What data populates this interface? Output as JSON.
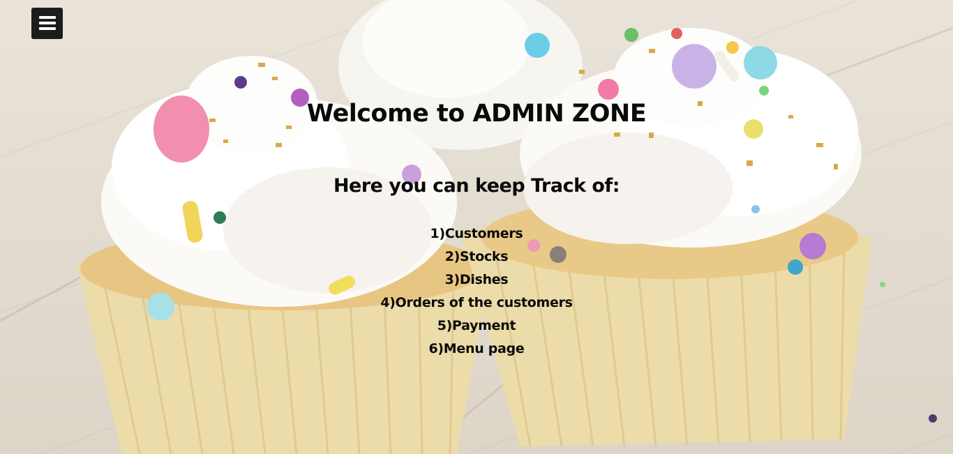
{
  "header": {
    "menu_icon": "hamburger-menu-icon"
  },
  "main": {
    "title": "Welcome to ADMIN ZONE",
    "subtitle": "Here you can keep Track of:",
    "items": [
      "1)Customers",
      "2)Stocks",
      "3)Dishes",
      "4)Orders of the customers",
      "5)Payment",
      "6)Menu page"
    ]
  },
  "colors": {
    "text": "#0a0a0a",
    "menu_button_bg": "#1c1c1c",
    "frosting": "#fbfaf7",
    "cake": "#e8c98c",
    "wrapper": "#efe0b4"
  }
}
